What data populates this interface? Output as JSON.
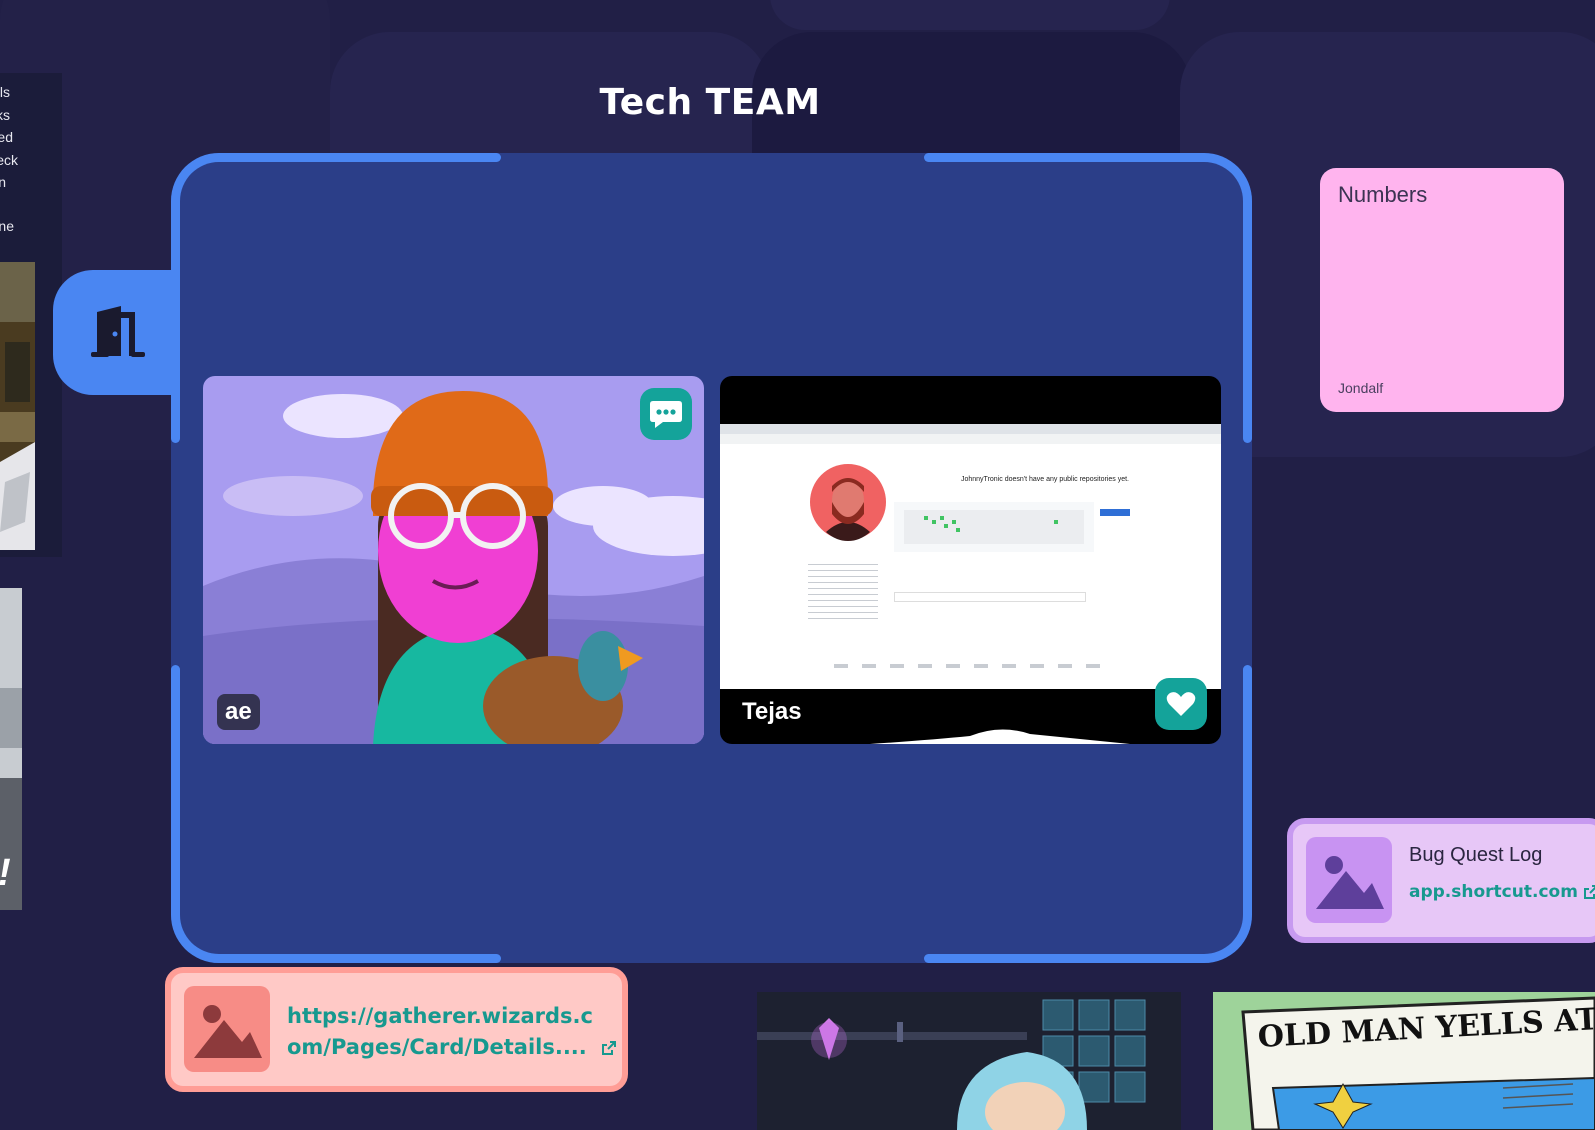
{
  "room": {
    "title": "Tech TEAM"
  },
  "left_panel": {
    "lines": [
      "ls",
      "ks",
      "ed",
      "eck",
      "n",
      "",
      "ne"
    ],
    "partial_text": "!"
  },
  "participants": [
    {
      "name": "ae",
      "action_icon": "chat-bubble-icon"
    },
    {
      "name": "Tejas",
      "action_icon": "heart-icon"
    }
  ],
  "screen_share": {
    "heading": "JohnnyTronic doesn't have any public repositories yet."
  },
  "sticky_note": {
    "title": "Numbers",
    "author": "Jondalf",
    "color": "#ffb4ee"
  },
  "link_cards": [
    {
      "title": "Bug Quest Log",
      "url": "app.shortcut.com",
      "color": "#e7c7f7"
    },
    {
      "title": "",
      "url_line1": "https://gatherer.wizards.c",
      "url_line2": "om/Pages/Card/Details....",
      "color": "#ffc9c6"
    }
  ],
  "comic": {
    "headline": "OLD MAN YELLS AT CLOU"
  },
  "colors": {
    "background": "#211f46",
    "room_fill": "#2b3e88",
    "room_border": "#4a86f2",
    "action_button": "#14a39a",
    "link_text": "#17998f"
  }
}
